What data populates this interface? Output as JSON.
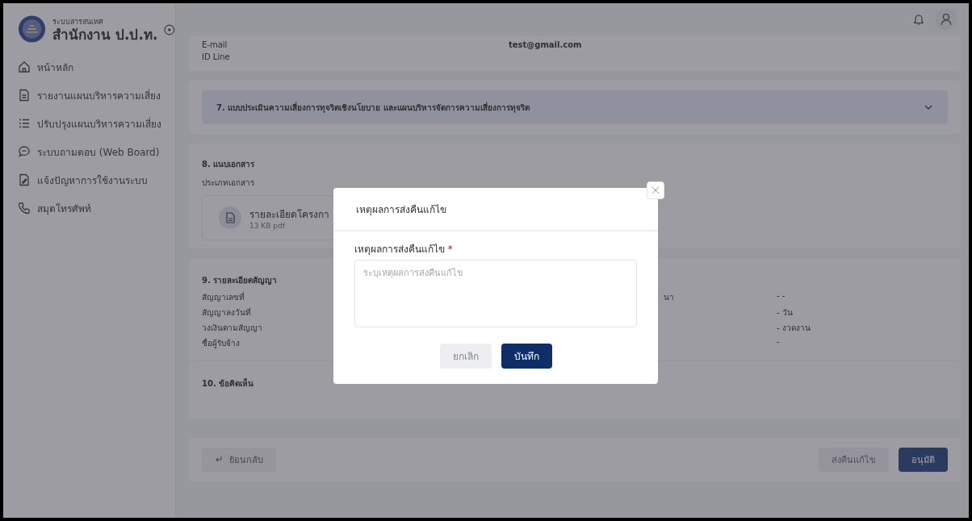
{
  "sidebar": {
    "brand_caption": "ระบบสารสนเทศ",
    "brand_title": "สำนักงาน ป.ป.ท.",
    "items": [
      {
        "label": "หน้าหลัก"
      },
      {
        "label": "รายงานแผนบริหารความเสี่ยง"
      },
      {
        "label": "ปรับปรุงแผนบริหารความเสี่ยง"
      },
      {
        "label": "ระบบถามตอบ (Web Board)"
      },
      {
        "label": "แจ้งปัญหาการใช้งานระบบ"
      },
      {
        "label": "สมุดโทรศัพท์"
      }
    ]
  },
  "contact": [
    {
      "label": "E-mail",
      "value": "test@gmail.com"
    },
    {
      "label": "ID Line"
    }
  ],
  "section_7": {
    "title": "7. แบบประเมินความเสี่ยงการทุจริตเชิงนโยบาย และแผนบริหารจัดการความเสี่ยงการทุจริต",
    "expanded": false
  },
  "section_8": {
    "title": "8. แนบเอกสาร",
    "label": "ประเภทเอกสาร",
    "file": {
      "name": "รายละเอียดโครงกา",
      "meta": "13 KB pdf"
    }
  },
  "section_9": {
    "title": "9. รายละเอียดสัญญา",
    "rows": [
      {
        "label": "สัญญาเลขที่",
        "partial_label": "นา",
        "value": "- -"
      },
      {
        "label": "สัญญาลงวันที่",
        "value": "- วัน"
      },
      {
        "label": "วงเงินตามสัญญา",
        "value": "- งวดงาน"
      },
      {
        "label": "ชื่อผู้รับจ้าง",
        "value": "-"
      }
    ]
  },
  "section_10": {
    "title": "10. ข้อคิดเห็น"
  },
  "footer": {
    "back": "ย้อนกลับ",
    "buttons": [
      {
        "label": "ส่งคืนแก้ไข",
        "kind": "secondary"
      },
      {
        "label": "อนุมัติ",
        "kind": "primary"
      }
    ]
  },
  "modal": {
    "title": "เหตุผลการส่งคืนแก้ไข",
    "field_label": "เหตุผลการส่งคืนแก้ไข",
    "required_mark": "*",
    "placeholder": "ระบุเหตุผลการส่งคืนแก้ไข",
    "cancel": "ยกเลิก",
    "save": "บันทึก"
  }
}
